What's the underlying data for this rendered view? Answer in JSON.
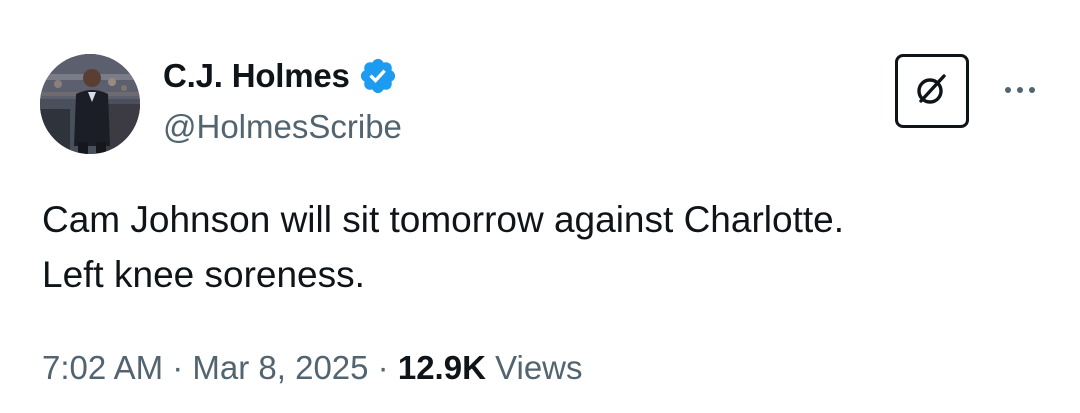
{
  "author": {
    "display_name": "C.J. Holmes",
    "handle": "@HolmesScribe",
    "verified": true,
    "verified_color": "#1d9bf0",
    "avatar_icon": "profile-photo"
  },
  "actions": {
    "grok_icon": "grok-icon",
    "more_icon": "more-horizontal-icon"
  },
  "tweet": {
    "text": "Cam Johnson will sit tomorrow against Charlotte.\nLeft knee soreness.",
    "time": "7:02 AM",
    "separator": " · ",
    "date": "Mar 8, 2025",
    "views_count": "12.9K",
    "views_label": " Views"
  },
  "colors": {
    "text_primary": "#0f1419",
    "text_secondary": "#536471"
  }
}
